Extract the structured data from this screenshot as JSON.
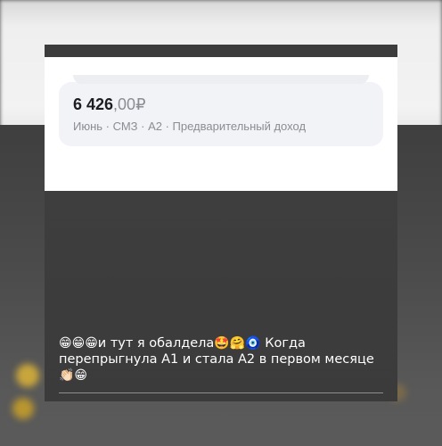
{
  "income": {
    "amount_int": "6 426",
    "amount_frac": ",00",
    "currency": "₽",
    "details": "Июнь · СМЗ · А2 · Предварительный доход"
  },
  "caption": {
    "leading_emojis": "😁😁😁",
    "text_part1": "и тут я обалдела",
    "mid_emojis": "🤩🤗🧿",
    "text_part2": " Когда перепрыгнула А1 и стала А2 в первом месяце ",
    "trailing_emojis": "👏🏻😁"
  },
  "colors": {
    "card_bg": "#f1f3f6",
    "muted_text": "#8a8d93",
    "amount_text": "#1d1d1f",
    "caption_text": "#ffffff"
  }
}
